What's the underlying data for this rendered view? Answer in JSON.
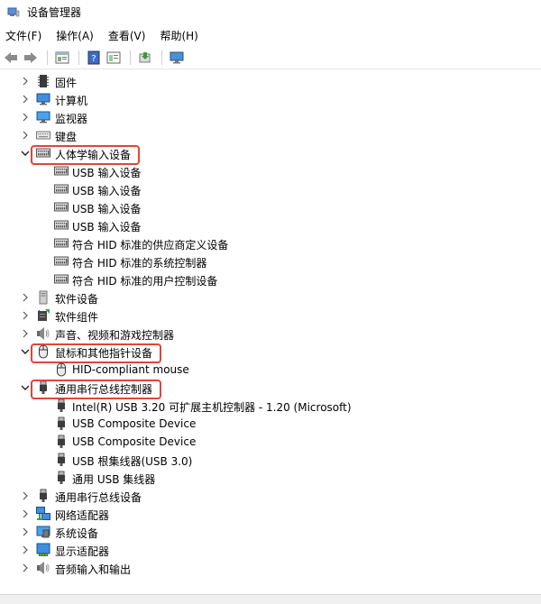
{
  "window": {
    "title": "设备管理器"
  },
  "menu": [
    "文件(F)",
    "操作(A)",
    "查看(V)",
    "帮助(H)"
  ],
  "toolbar_icons": [
    "back-icon",
    "forward-icon",
    "properties-icon",
    "help-icon",
    "view-icon",
    "update-driver-icon",
    "monitor-icon"
  ],
  "tree": [
    {
      "label": "固件",
      "level": 0,
      "expander": "right",
      "icon": "firmware-icon"
    },
    {
      "label": "计算机",
      "level": 0,
      "expander": "right",
      "icon": "computer-icon"
    },
    {
      "label": "监视器",
      "level": 0,
      "expander": "right",
      "icon": "monitor-icon"
    },
    {
      "label": "键盘",
      "level": 0,
      "expander": "right",
      "icon": "keyboard-icon"
    },
    {
      "label": "人体学输入设备",
      "level": 0,
      "expander": "down",
      "icon": "hid-icon",
      "highlight": true
    },
    {
      "label": "USB 输入设备",
      "level": 1,
      "icon": "hid-icon"
    },
    {
      "label": "USB 输入设备",
      "level": 1,
      "icon": "hid-icon"
    },
    {
      "label": "USB 输入设备",
      "level": 1,
      "icon": "hid-icon"
    },
    {
      "label": "USB 输入设备",
      "level": 1,
      "icon": "hid-icon"
    },
    {
      "label": "符合 HID 标准的供应商定义设备",
      "level": 1,
      "icon": "hid-icon"
    },
    {
      "label": "符合 HID 标准的系统控制器",
      "level": 1,
      "icon": "hid-icon"
    },
    {
      "label": "符合 HID 标准的用户控制设备",
      "level": 1,
      "icon": "hid-icon"
    },
    {
      "label": "软件设备",
      "level": 0,
      "expander": "right",
      "icon": "software-device-icon"
    },
    {
      "label": "软件组件",
      "level": 0,
      "expander": "right",
      "icon": "software-component-icon"
    },
    {
      "label": "声音、视频和游戏控制器",
      "level": 0,
      "expander": "right",
      "icon": "speaker-icon"
    },
    {
      "label": "鼠标和其他指针设备",
      "level": 0,
      "expander": "down",
      "icon": "mouse-icon",
      "highlight": true
    },
    {
      "label": "HID-compliant mouse",
      "level": 1,
      "icon": "mouse-icon"
    },
    {
      "label": "通用串行总线控制器",
      "level": 0,
      "expander": "down",
      "icon": "usb-icon",
      "highlight": true
    },
    {
      "label": "Intel(R) USB 3.20 可扩展主机控制器 - 1.20 (Microsoft)",
      "level": 1,
      "icon": "usb-icon"
    },
    {
      "label": "USB Composite Device",
      "level": 1,
      "icon": "usb-icon"
    },
    {
      "label": "USB Composite Device",
      "level": 1,
      "icon": "usb-icon"
    },
    {
      "label": "USB 根集线器(USB 3.0)",
      "level": 1,
      "icon": "usb-icon"
    },
    {
      "label": "通用 USB 集线器",
      "level": 1,
      "icon": "usb-icon"
    },
    {
      "label": "通用串行总线设备",
      "level": 0,
      "expander": "right",
      "icon": "usb-icon"
    },
    {
      "label": "网络适配器",
      "level": 0,
      "expander": "right",
      "icon": "network-icon"
    },
    {
      "label": "系统设备",
      "level": 0,
      "expander": "right",
      "icon": "system-icon"
    },
    {
      "label": "显示适配器",
      "level": 0,
      "expander": "right",
      "icon": "display-adapter-icon"
    },
    {
      "label": "音频输入和输出",
      "level": 0,
      "expander": "right",
      "icon": "audio-icon"
    }
  ],
  "colors": {
    "highlight_border": "#e0453a"
  }
}
